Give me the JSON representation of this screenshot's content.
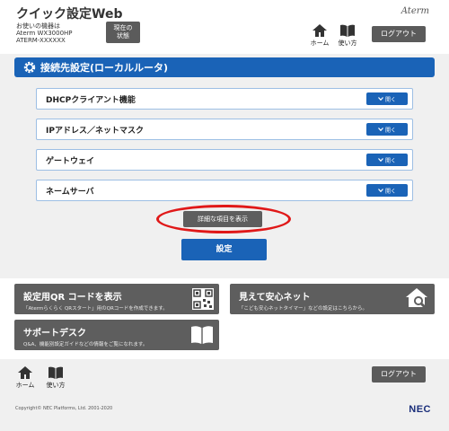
{
  "header": {
    "title": "クイック設定Web",
    "device_intro": "お使いの機器は",
    "model": "Aterm WX3000HP",
    "device_name": "ATERM-XXXXXX",
    "status_line1": "現在の",
    "status_line2": "状態",
    "brand": "Aterm",
    "home_label": "ホーム",
    "howto_label": "使い方",
    "logout_label": "ログアウト"
  },
  "section": {
    "title": "接続先設定(ローカルルータ)",
    "rows": [
      {
        "label": "DHCPクライアント機能",
        "button": "開く"
      },
      {
        "label": "IPアドレス／ネットマスク",
        "button": "開く"
      },
      {
        "label": "ゲートウェイ",
        "button": "開く"
      },
      {
        "label": "ネームサーバ",
        "button": "開く"
      }
    ],
    "detail_button": "詳細な項目を表示",
    "settings_button": "設定"
  },
  "tiles": {
    "qr": {
      "title": "設定用QR コードを表示",
      "desc": "「Atermらくらく QRスタート」用のQRコードを作成できます。"
    },
    "safety": {
      "title": "見えて安心ネット",
      "desc": "「こども安心ネットタイマー」などの設定はこちらから。"
    },
    "support": {
      "title": "サポートデスク",
      "desc": "Q&A、機能別設定ガイドなどの情報をご覧になれます。"
    }
  },
  "footer": {
    "home_label": "ホーム",
    "howto_label": "使い方",
    "logout_label": "ログアウト",
    "copyright": "Copyright© NEC Platforms, Ltd. 2001-2020",
    "company": "NEC"
  },
  "colors": {
    "accent": "#1a63b7",
    "tile": "#5e5e5e",
    "highlight_oval": "#e01818"
  }
}
